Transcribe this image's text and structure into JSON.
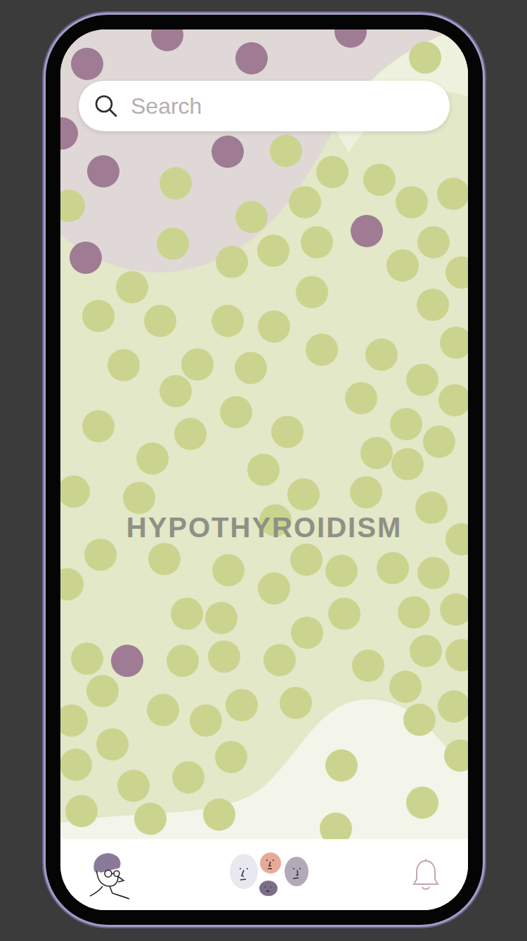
{
  "search": {
    "placeholder": "Search"
  },
  "title": "HYPOTHYROIDISM"
}
